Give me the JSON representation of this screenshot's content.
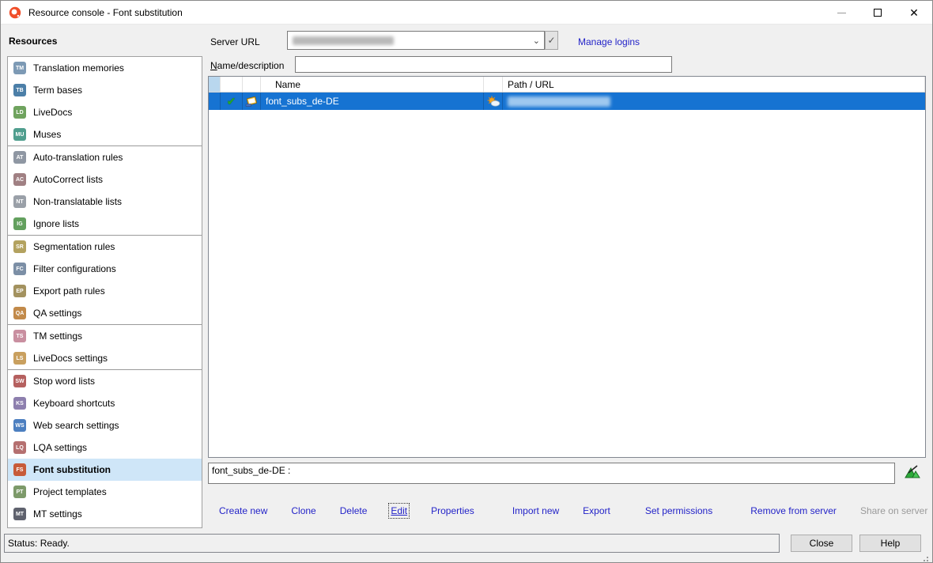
{
  "window": {
    "title": "Resource console - Font substitution",
    "controls": {
      "minimize": "minimize",
      "maximize": "maximize",
      "close": "close"
    }
  },
  "colors": {
    "selection_blue": "#1673d2",
    "sidebar_selected": "#cfe6f8",
    "link": "#2323c8",
    "header_selector_cell": "#b9d7ee"
  },
  "resources_header": "Resources",
  "sidebar": {
    "items": [
      {
        "label": "Translation memories",
        "icon": "translation-memories-icon",
        "glyph": "TM",
        "color": "#7d9ab5"
      },
      {
        "label": "Term bases",
        "icon": "term-bases-icon",
        "glyph": "TB",
        "color": "#4c7fa8"
      },
      {
        "label": "LiveDocs",
        "icon": "livedocs-icon",
        "glyph": "LD",
        "color": "#6fa35e"
      },
      {
        "label": "Muses",
        "icon": "muses-icon",
        "glyph": "MU",
        "color": "#4f9e8e",
        "divider_after": true
      },
      {
        "label": "Auto-translation rules",
        "icon": "auto-translation-rules-icon",
        "glyph": "AT",
        "color": "#8f97a3"
      },
      {
        "label": "AutoCorrect lists",
        "icon": "autocorrect-lists-icon",
        "glyph": "AC",
        "color": "#a08083"
      },
      {
        "label": "Non-translatable lists",
        "icon": "non-translatable-lists-icon",
        "glyph": "NT",
        "color": "#9aa0a8"
      },
      {
        "label": "Ignore lists",
        "icon": "ignore-lists-icon",
        "glyph": "IG",
        "color": "#63a05e",
        "divider_after": true
      },
      {
        "label": "Segmentation rules",
        "icon": "segmentation-rules-icon",
        "glyph": "SR",
        "color": "#b3a25f"
      },
      {
        "label": "Filter configurations",
        "icon": "filter-configurations-icon",
        "glyph": "FC",
        "color": "#7c8fa6"
      },
      {
        "label": "Export path rules",
        "icon": "export-path-rules-icon",
        "glyph": "EP",
        "color": "#a3925f"
      },
      {
        "label": "QA settings",
        "icon": "qa-settings-icon",
        "glyph": "QA",
        "color": "#c28a4a",
        "divider_after": true
      },
      {
        "label": "TM settings",
        "icon": "tm-settings-icon",
        "glyph": "TS",
        "color": "#c98fa0"
      },
      {
        "label": "LiveDocs settings",
        "icon": "livedocs-settings-icon",
        "glyph": "LS",
        "color": "#c9a05f",
        "divider_after": true
      },
      {
        "label": "Stop word lists",
        "icon": "stop-word-lists-icon",
        "glyph": "SW",
        "color": "#b5605f"
      },
      {
        "label": "Keyboard shortcuts",
        "icon": "keyboard-shortcuts-icon",
        "glyph": "KS",
        "color": "#8d7fae"
      },
      {
        "label": "Web search settings",
        "icon": "web-search-settings-icon",
        "glyph": "WS",
        "color": "#4c7fc0"
      },
      {
        "label": "LQA settings",
        "icon": "lqa-settings-icon",
        "glyph": "LQ",
        "color": "#b57070"
      },
      {
        "label": "Font substitution",
        "icon": "font-substitution-icon",
        "glyph": "FS",
        "color": "#c75b39",
        "selected": true
      },
      {
        "label": "Project templates",
        "icon": "project-templates-icon",
        "glyph": "PT",
        "color": "#7d9a6a"
      },
      {
        "label": "MT settings",
        "icon": "mt-settings-icon",
        "glyph": "MT",
        "color": "#5f626e"
      }
    ]
  },
  "server": {
    "label": "Server URL",
    "value_redacted": true,
    "check_button": "✓",
    "chevron": "⌄",
    "manage_logins": "Manage logins"
  },
  "filter": {
    "label_mnemonic": "N",
    "label_rest": "ame/description",
    "value": "",
    "placeholder": ""
  },
  "table": {
    "columns": [
      "",
      "",
      "",
      "Name",
      "",
      "Path / URL"
    ],
    "rows": [
      {
        "checked": true,
        "name": "font_subs_de-DE",
        "cloud_resource": true,
        "path_redacted": true
      }
    ]
  },
  "description": {
    "value": "font_subs_de-DE :"
  },
  "toolbar": {
    "items": [
      {
        "type": "link",
        "label": "Create new"
      },
      {
        "type": "link",
        "label": "Clone"
      },
      {
        "type": "link",
        "label": "Delete"
      },
      {
        "type": "link",
        "label": "Edit",
        "focused": true
      },
      {
        "type": "link",
        "label": "Properties"
      },
      {
        "type": "sep"
      },
      {
        "type": "link",
        "label": "Import new"
      },
      {
        "type": "link",
        "label": "Export",
        "gap_wide": true
      },
      {
        "type": "link",
        "label": "Set permissions"
      },
      {
        "type": "sep"
      },
      {
        "type": "link",
        "label": "Remove from server"
      },
      {
        "type": "link",
        "label": "Share on server",
        "disabled": true
      }
    ]
  },
  "status": {
    "text": "Status: Ready."
  },
  "buttons": {
    "close": "Close",
    "help": "Help"
  }
}
